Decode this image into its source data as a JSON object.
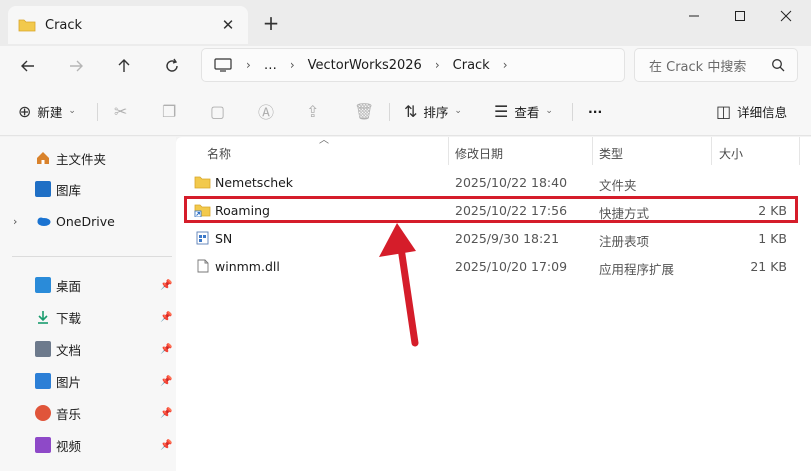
{
  "window": {
    "tab_title": "Crack",
    "new_tab": "+"
  },
  "address": {
    "more": "…",
    "crumbs": [
      "VectorWorks2026",
      "Crack"
    ]
  },
  "search": {
    "placeholder": "在 Crack 中搜索"
  },
  "commands": {
    "new_label": "新建",
    "sort_label": "排序",
    "view_label": "查看",
    "more": "···",
    "details_label": "详细信息"
  },
  "sidebar": {
    "items": [
      {
        "label": "主文件夹",
        "icon": "home-icon",
        "color": "#d9822b"
      },
      {
        "label": "图库",
        "icon": "gallery-icon",
        "color": "#1f6fc5"
      },
      {
        "label": "OneDrive",
        "icon": "cloud-icon",
        "color": "#1a73d1"
      },
      {
        "label": "桌面",
        "icon": "desktop-icon",
        "color": "#2a8bd9"
      },
      {
        "label": "下载",
        "icon": "download-icon",
        "color": "#1a9c6e"
      },
      {
        "label": "文档",
        "icon": "documents-icon",
        "color": "#6d7a8c"
      },
      {
        "label": "图片",
        "icon": "pictures-icon",
        "color": "#2c7fd6"
      },
      {
        "label": "音乐",
        "icon": "music-icon",
        "color": "#e0553a"
      },
      {
        "label": "视频",
        "icon": "videos-icon",
        "color": "#8e49c8"
      }
    ]
  },
  "columns": {
    "name": "名称",
    "date": "修改日期",
    "type": "类型",
    "size": "大小"
  },
  "files": [
    {
      "name": "Nemetschek",
      "date": "2025/10/22 18:40",
      "type": "文件夹",
      "size": "",
      "icon": "folder-icon"
    },
    {
      "name": "Roaming",
      "date": "2025/10/22 17:56",
      "type": "快捷方式",
      "size": "2 KB",
      "icon": "shortcut-folder-icon"
    },
    {
      "name": "SN",
      "date": "2025/9/30 18:21",
      "type": "注册表项",
      "size": "1 KB",
      "icon": "registry-icon"
    },
    {
      "name": "winmm.dll",
      "date": "2025/10/20 17:09",
      "type": "应用程序扩展",
      "size": "21 KB",
      "icon": "dll-icon"
    }
  ],
  "colors": {
    "highlight": "#d51d2a",
    "folder": "#f2c94c"
  }
}
